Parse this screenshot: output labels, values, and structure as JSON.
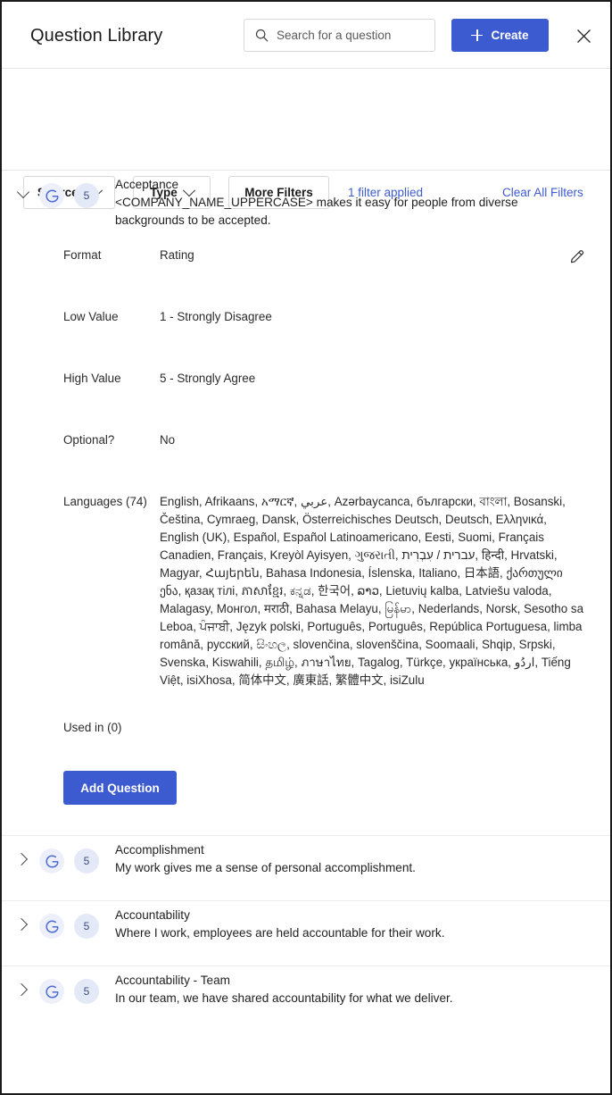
{
  "header": {
    "title": "Question Library",
    "search": {
      "placeholder": "Search for a question",
      "value": "",
      "icon": "search-icon"
    },
    "create_button": {
      "label": "Create",
      "icon": "plus-icon",
      "color": "#3d5bd0"
    },
    "close_icon": "close-icon"
  },
  "filters": {
    "sources_label": "Sources",
    "type_label": "Type",
    "more_filters_label": "More Filters",
    "applied_label": "1 filter applied",
    "clear_label": "Clear All Filters",
    "link_color": "#3d5bd0"
  },
  "questions": [
    {
      "expanded": true,
      "source_icon": "google-g-icon",
      "scale_badge": "5",
      "title": "Acceptance",
      "body": "<COMPANY_NAME_UPPERCASE> makes it easy for people from diverse backgrounds to be accepted.",
      "details": [
        {
          "label": "Format",
          "value": "Rating"
        },
        {
          "label": "Low Value",
          "value": "1 - Strongly Disagree"
        },
        {
          "label": "High Value",
          "value": "5 - Strongly Agree"
        },
        {
          "label": "Optional?",
          "value": "No"
        }
      ],
      "languages_label": "Languages (74)",
      "languages_count": 74,
      "languages_value": "English, Afrikaans, አማርኛ, عربي, Azərbaycanca, български, বাংলা, Bosanski, Čeština, Cymraeg, Dansk, Österreichisches Deutsch, Deutsch, Ελληνικά, English (UK), Español, Español Latinoamericano, Eesti, Suomi, Français Canadien, Français, Kreyòl Ayisyen, ગુજરાતી, עברית / עִבְרִית, हिन्दी, Hrvatski, Magyar, Հայերեն, Bahasa Indonesia, Íslenska, Italiano, 日本語, ქართული ენა, қазақ тілі, ភាសាខ្មែរ, ಕನ್ನಡ, 한국어, ລາວ, Lietuvių kalba, Latviešu valoda, Malagasy, Монгол, मराठी, Bahasa Melayu, မြန်မာ, Nederlands, Norsk, Sesotho sa Leboa, ਪੰਜਾਬੀ, Język polski, Português, Português, República Portuguesa, limba română, русский, සිංහල, slovenčina, slovenščina, Soomaali, Shqip, Srpski, Svenska, Kiswahili, தமிழ், ภาษาไทย, Tagalog, Türkçe, українська, اردُو, Tiếng Việt, isiXhosa, 简体中文, 廣東話, 繁體中文, isiZulu",
      "used_in_label": "Used in (0)",
      "edit_icon": "pencil-icon",
      "add_button_label": "Add Question"
    },
    {
      "expanded": false,
      "source_icon": "google-g-icon",
      "scale_badge": "5",
      "title": "Accomplishment",
      "body": "My work gives me a sense of personal accomplishment."
    },
    {
      "expanded": false,
      "source_icon": "google-g-icon",
      "scale_badge": "5",
      "title": "Accountability",
      "body": "Where I work, employees are held accountable for their work."
    },
    {
      "expanded": false,
      "source_icon": "google-g-icon",
      "scale_badge": "5",
      "title": "Accountability - Team",
      "body": "In our team, we have shared accountability for what we deliver."
    }
  ]
}
